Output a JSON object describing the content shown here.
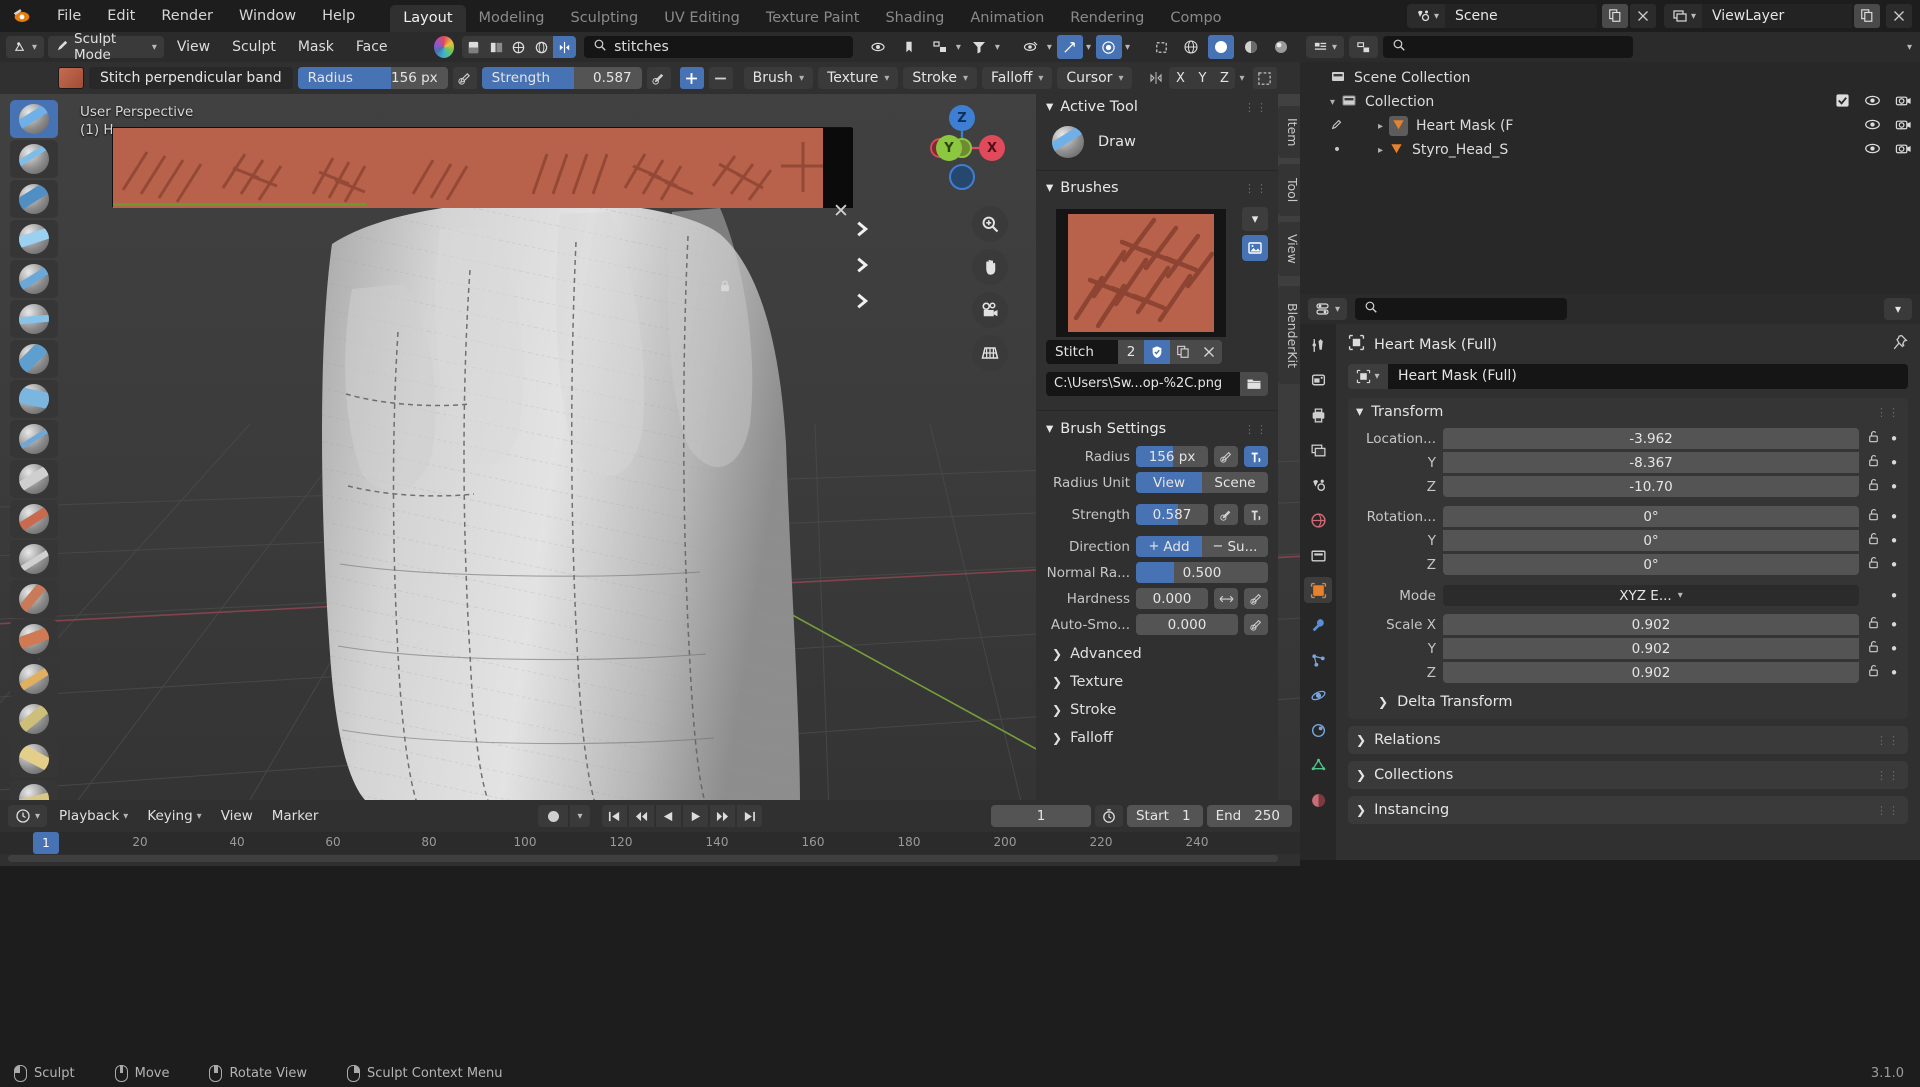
{
  "app": {
    "version": "3.1.0",
    "logo_icon": "blender-logo"
  },
  "topbar": {
    "menus": [
      "File",
      "Edit",
      "Render",
      "Window",
      "Help"
    ],
    "workspaces": [
      {
        "label": "Layout",
        "active": true
      },
      {
        "label": "Modeling",
        "active": false
      },
      {
        "label": "Sculpting",
        "active": false
      },
      {
        "label": "UV Editing",
        "active": false
      },
      {
        "label": "Texture Paint",
        "active": false
      },
      {
        "label": "Shading",
        "active": false
      },
      {
        "label": "Animation",
        "active": false
      },
      {
        "label": "Rendering",
        "active": false
      },
      {
        "label": "Compo",
        "active": false
      }
    ],
    "scene_name": "Scene",
    "viewlayer_name": "ViewLayer",
    "scene_icon": "scene-data-icon",
    "viewlayer_icon": "viewlayer-icon",
    "new_scene_icon": "copy-icon",
    "remove_scene_icon": "close-icon"
  },
  "viewport_header": {
    "editor_type_icon": "editor-type-icon",
    "mode": "Sculpt Mode",
    "mode_icon": "sculpt-mode-icon",
    "menus": [
      "View",
      "Sculpt",
      "Mask",
      "Face Sets"
    ],
    "search_value": "stitches",
    "search_icon": "search-icon",
    "color_icon": "colorwheel-icon",
    "toggle_icons": [
      "mask-icon",
      "face-sets-icon",
      "dyntopo-icon",
      "remesh-icon",
      "symmetry-icon"
    ],
    "visibility_icon": "eye-icon",
    "gizmo_icon": "gizmo-icon",
    "overlay_icon": "overlays-icon",
    "filter_icon": "filter-icon",
    "xray_icon": "xray-icon",
    "shading_icons": [
      "wireframe-icon",
      "solid-icon",
      "material-icon",
      "rendered-icon"
    ]
  },
  "tool_header": {
    "brush_swatch_icon": "brush-swatch-icon",
    "brush_name": "Stitch perpendicular band",
    "radius_label": "Radius",
    "radius_value": "156 px",
    "radius_fill_pct": 62,
    "radius_pressure_icon": "pressure-icon",
    "strength_label": "Strength",
    "strength_value": "0.587",
    "strength_fill_pct": 58,
    "strength_pressure_icon": "pressure-icon",
    "add_icon": "plus-icon",
    "subtract_icon": "minus-icon",
    "popovers": [
      "Brush",
      "Texture",
      "Stroke",
      "Falloff",
      "Cursor"
    ],
    "symmetry_icon": "symmetry-icon",
    "symmetry_axes": [
      "X",
      "Y",
      "Z"
    ],
    "options_icon": "options-icon"
  },
  "viewport": {
    "perspective_label": "User Perspective",
    "collection_label": "(1) H",
    "close_icon": "close-icon",
    "lock_icon": "lock-icon",
    "chevron_icon": "chevron-right-icon",
    "texture_strip_name": "brush-texture-strip",
    "tools": [
      {
        "name": "draw",
        "active": true
      },
      {
        "name": "draw-sharp",
        "active": false
      },
      {
        "name": "clay",
        "active": false
      },
      {
        "name": "clay-strips",
        "active": false
      },
      {
        "name": "clay-thumb",
        "active": false
      },
      {
        "name": "layer",
        "active": false
      },
      {
        "name": "inflate",
        "active": false
      },
      {
        "name": "blob",
        "active": false
      },
      {
        "name": "crease",
        "active": false
      },
      {
        "name": "smooth",
        "active": false
      },
      {
        "name": "flatten",
        "active": false
      },
      {
        "name": "fill",
        "active": false
      },
      {
        "name": "scrape",
        "active": false
      },
      {
        "name": "multi-plane-scrape",
        "active": false
      },
      {
        "name": "pinch",
        "active": false
      },
      {
        "name": "grab",
        "active": false
      },
      {
        "name": "elastic-deform",
        "active": false
      },
      {
        "name": "snake-hook",
        "active": false
      }
    ],
    "gizmo": {
      "axes": [
        {
          "label": "Z",
          "color": "#3e7fd4"
        },
        {
          "label": "Y",
          "color": "#8bc73f"
        },
        {
          "label": "X",
          "color": "#e04a5a"
        }
      ]
    },
    "nav_buttons": [
      "zoom-icon",
      "pan-hand-icon",
      "camera-icon",
      "ortho-grid-icon"
    ],
    "side_tabs": [
      "Item",
      "Tool",
      "View",
      "BlenderKit"
    ]
  },
  "npanel": {
    "active_tool": {
      "title": "Active Tool",
      "tool_name": "Draw",
      "tool_icon": "brush-draw-icon"
    },
    "brushes": {
      "title": "Brushes",
      "preview_name": "brush-texture-preview",
      "brush_short_name": "Stitch ...",
      "user_count": "2",
      "fake_user_icon": "shield-icon",
      "duplicate_icon": "copy-icon",
      "unlink_icon": "close-icon",
      "texture_path": "C:\\Users\\Sw...op-%2C.png",
      "folder_icon": "folder-icon",
      "browse_icon": "chevron-down-icon",
      "image_icon": "image-icon"
    },
    "brush_settings": {
      "title": "Brush Settings",
      "rows": [
        {
          "label": "Radius",
          "value": "156 px",
          "fill_pct": 52,
          "type": "slider",
          "icons": [
            "pressure-icon",
            "unified-icon"
          ],
          "unified_on": true
        },
        {
          "label": "Radius Unit",
          "type": "segmented",
          "options": [
            "View",
            "Scene"
          ],
          "selected": "View"
        },
        {
          "label": "Strength",
          "value": "0.587",
          "fill_pct": 58,
          "type": "slider",
          "icons": [
            "pressure-icon",
            "unified-icon"
          ],
          "unified_on": false
        },
        {
          "label": "Direction",
          "type": "segmented",
          "options": [
            "Add",
            "Su..."
          ],
          "selected": "Add"
        },
        {
          "label": "Normal Ra...",
          "value": "0.500",
          "fill_pct": 29,
          "type": "slider",
          "icons": []
        },
        {
          "label": "Hardness",
          "value": "0.000",
          "fill_pct": 0,
          "type": "slider",
          "icons": [
            "arrows-icon",
            "pressure-icon"
          ]
        },
        {
          "label": "Auto-Smo...",
          "value": "0.000",
          "fill_pct": 0,
          "type": "slider",
          "icons": [
            "pressure-icon"
          ]
        }
      ],
      "closed_sections": [
        "Advanced",
        "Texture",
        "Stroke",
        "Falloff"
      ]
    }
  },
  "outliner": {
    "display_mode_icon": "outliner-view-icon",
    "filter_icon": "filter-icon",
    "search_icon": "search-icon",
    "search_placeholder": "",
    "rows": [
      {
        "label": "Scene Collection",
        "icon": "collection-icon",
        "indent": 0,
        "disclosure": "",
        "checkbox": false,
        "eye": false,
        "camera": false
      },
      {
        "label": "Collection",
        "icon": "collection-icon",
        "indent": 1,
        "disclosure": "down",
        "checkbox": true,
        "eye": true,
        "camera": true
      },
      {
        "label": "Heart Mask (F",
        "icon": "mesh-object-icon",
        "indent": 2,
        "disclosure": "right",
        "checkbox": false,
        "eye": true,
        "camera": true,
        "active": true
      },
      {
        "label": "Styro_Head_S",
        "icon": "mesh-object-icon",
        "indent": 2,
        "disclosure": "right",
        "checkbox": false,
        "eye": true,
        "camera": true,
        "active": false
      }
    ]
  },
  "properties": {
    "editor_icon": "properties-editor-icon",
    "search_placeholder": "",
    "search_icon": "search-icon",
    "options_icon": "chevron-down-icon",
    "tabs": [
      {
        "name": "tool",
        "icon": "tool-icon",
        "active": false
      },
      {
        "name": "render",
        "icon": "render-icon",
        "active": false
      },
      {
        "name": "output",
        "icon": "printer-icon",
        "active": false
      },
      {
        "name": "view-layer",
        "icon": "images-icon",
        "active": false
      },
      {
        "name": "scene",
        "icon": "scene-icon",
        "active": false
      },
      {
        "name": "world",
        "icon": "world-icon",
        "active": false
      },
      {
        "name": "collection",
        "icon": "collection-props-icon",
        "active": false
      },
      {
        "name": "object",
        "icon": "object-icon",
        "active": true
      },
      {
        "name": "modifiers",
        "icon": "wrench-icon",
        "active": false
      },
      {
        "name": "particles",
        "icon": "particles-icon",
        "active": false
      },
      {
        "name": "physics",
        "icon": "physics-icon",
        "active": false
      },
      {
        "name": "constraints",
        "icon": "constraints-icon",
        "active": false
      },
      {
        "name": "data",
        "icon": "mesh-data-icon",
        "active": false
      },
      {
        "name": "material",
        "icon": "material-icon",
        "active": false
      }
    ],
    "breadcrumb": "Heart Mask (Full)",
    "breadcrumb_icon": "object-icon",
    "pin_icon": "pin-icon",
    "object_name": "Heart Mask (Full)",
    "transform": {
      "title": "Transform",
      "location": {
        "label": "Location...",
        "x": "-3.962",
        "y": "-8.367",
        "z": "-10.70"
      },
      "rotation": {
        "label": "Rotation...",
        "x": "0°",
        "y": "0°",
        "z": "0°"
      },
      "mode": {
        "label": "Mode",
        "value": "XYZ E..."
      },
      "scale": {
        "label": "Scale X",
        "x": "0.902",
        "y": "0.902",
        "z": "0.902"
      },
      "axis_y": "Y",
      "axis_z": "Z",
      "delta_transform": "Delta Transform",
      "lock_icon": "unlock-icon",
      "anim_icon": "animate-dot-icon"
    },
    "closed_panels": [
      "Relations",
      "Collections",
      "Instancing"
    ]
  },
  "timeline": {
    "editor_icon": "timeline-editor-icon",
    "menus": [
      "Playback",
      "Keying",
      "View",
      "Marker"
    ],
    "record_icon": "record-icon",
    "transport": [
      "jump-start-icon",
      "prev-keyframe-icon",
      "play-reverse-icon",
      "play-icon",
      "next-keyframe-icon",
      "jump-end-icon"
    ],
    "current_frame": "1",
    "autokey_icon": "stopwatch-icon",
    "start_label": "Start",
    "start_value": "1",
    "end_label": "End",
    "end_value": "250",
    "playhead_frame": "1",
    "ruler_ticks": [
      "20",
      "40",
      "60",
      "80",
      "100",
      "120",
      "140",
      "160",
      "180",
      "200",
      "220",
      "240"
    ]
  },
  "statusbar": {
    "items": [
      {
        "icon": "mouse-left-icon",
        "label": "Sculpt"
      },
      {
        "icon": "mouse-middle-icon",
        "label": "Move"
      },
      {
        "icon": "mouse-middle-icon",
        "label": "Rotate View"
      },
      {
        "icon": "mouse-right-icon",
        "label": "Sculpt Context Menu"
      }
    ],
    "version": "3.1.0"
  },
  "colors": {
    "accent_blue": "#4772b3",
    "brush_orange": "#b8624c",
    "axis_x": "#e04a5a",
    "axis_y": "#8bc73f",
    "axis_z": "#3e7fd4",
    "object_orange": "#e8802c",
    "panel_bg": "#303030",
    "header_bg": "#2b2b2b",
    "viewport_bg": "#3a3a3a"
  }
}
